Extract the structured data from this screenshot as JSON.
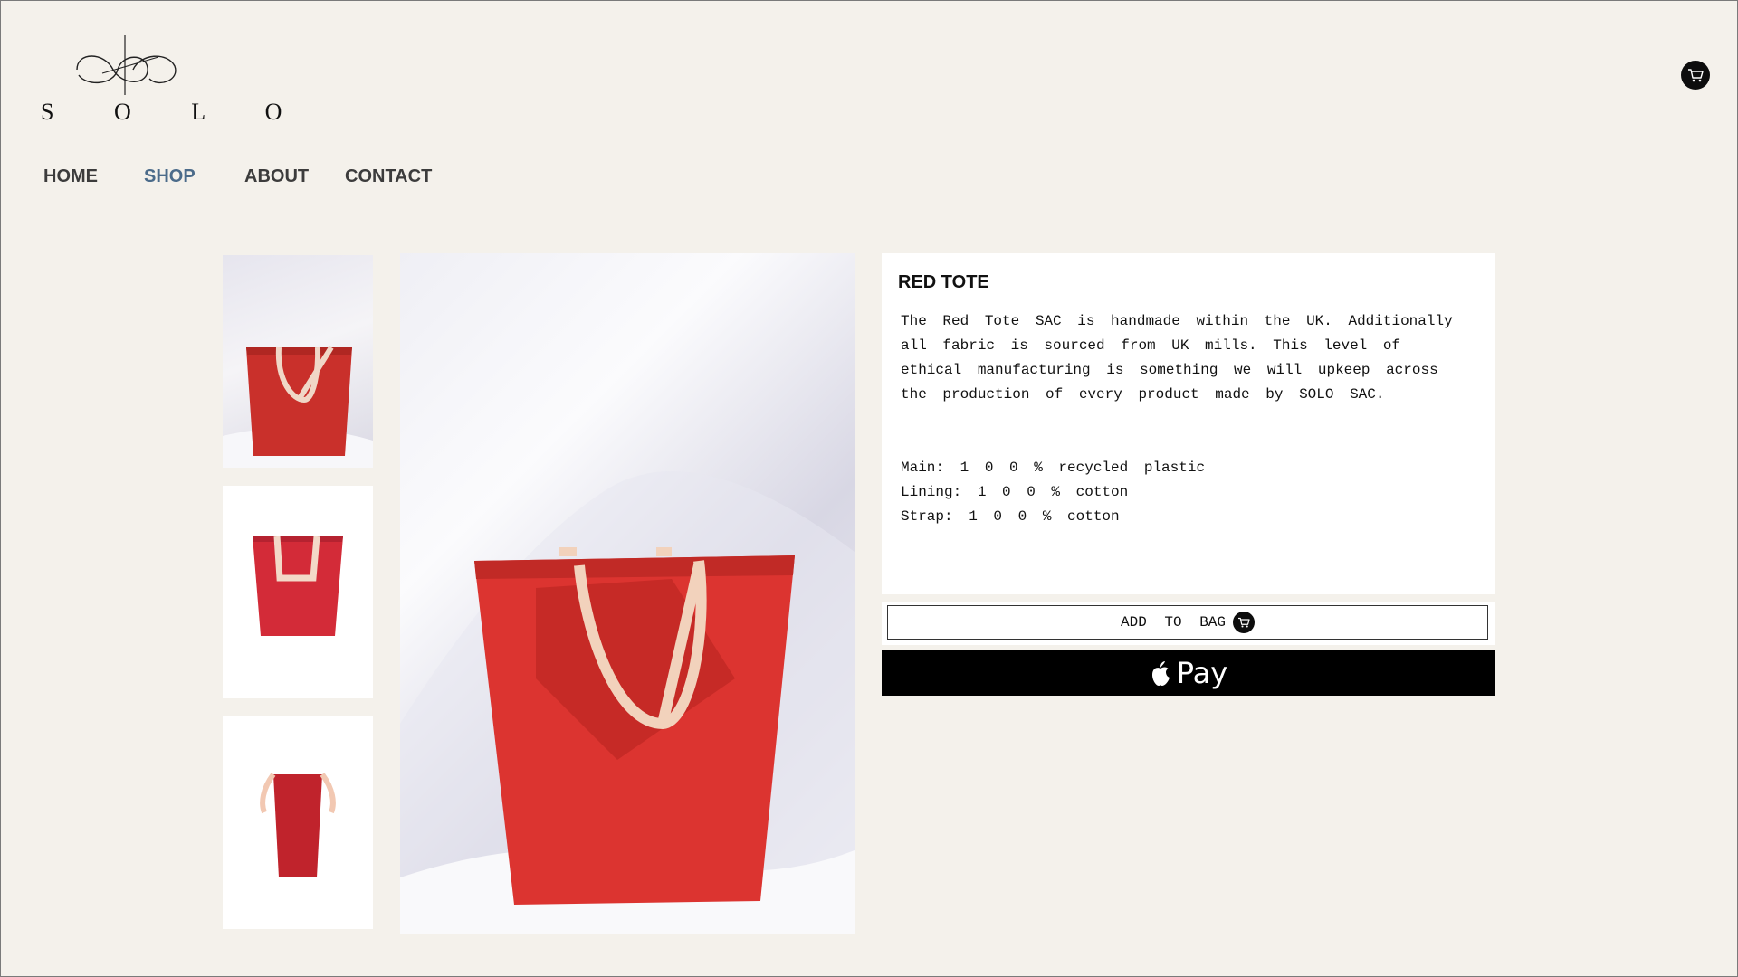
{
  "brand": {
    "logo_text": "S O L O"
  },
  "nav": {
    "items": [
      "HOME",
      "SHOP",
      "ABOUT",
      "CONTACT"
    ],
    "active": "SHOP",
    "active_color": "#4b6b8a"
  },
  "product": {
    "title": "RED TOTE",
    "description": "The Red Tote SAC is handmade within the UK. Additionally\nall fabric is sourced from UK mills.  This level of\nethical manufacturing is something we will upkeep across\nthe production of every product made by SOLO SAC.",
    "specs": [
      "Main: 1 0 0 % recycled plastic",
      "Lining: 1 0 0 % cotton",
      "Strap: 1 0 0 % cotton"
    ],
    "color": "#d8322e"
  },
  "actions": {
    "add_to_bag": "ADD TO BAG",
    "apple_pay": "Pay"
  },
  "icons": {
    "cart": "cart-icon",
    "apple": "apple-logo-icon"
  },
  "colors": {
    "background": "#f4f1eb",
    "panel": "#ffffff",
    "bag_red": "#d8322e"
  }
}
